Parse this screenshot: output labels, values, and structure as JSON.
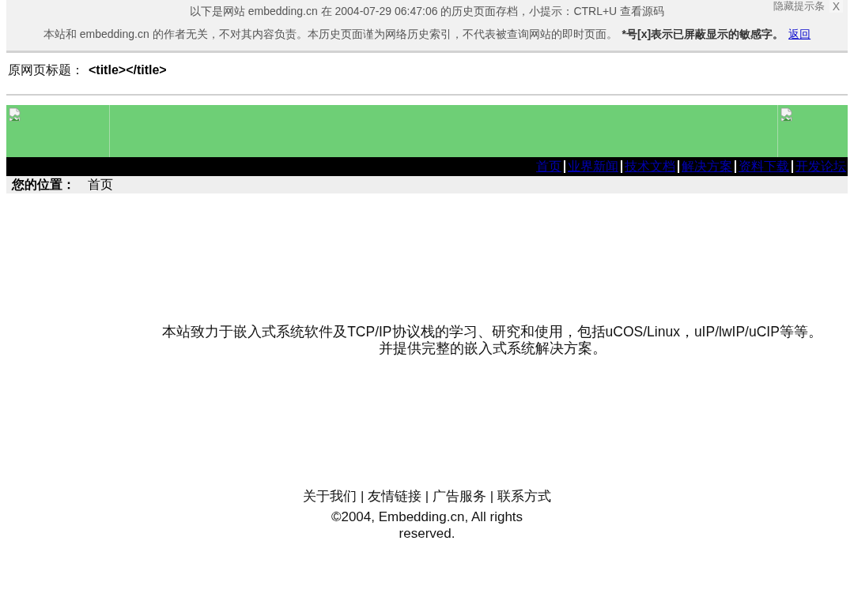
{
  "archive_notice": {
    "archived_line": "以下是网站 embedding.cn 在 2004-07-29 06:47:06 的历史页面存档，小提示：CTRL+U 查看源码",
    "hide_link": "隐藏提示条",
    "close_button": "X",
    "disclaimer": "本站和 embedding.cn 的作者无关，不对其内容负责。本历史页面谨为网络历史索引，不代表被查询网站的即时页面。",
    "disclaimer_emphasis": "*号[x]表示已屏蔽显示的敏感字。",
    "back_link": "返回"
  },
  "original_title": {
    "label": "原网页标题：",
    "value": "<title></title>"
  },
  "nav_links": [
    {
      "label": "首页"
    },
    {
      "label": "业界新闻"
    },
    {
      "label": "技术文档"
    },
    {
      "label": "解决方案"
    },
    {
      "label": "资料下载"
    },
    {
      "label": "开发论坛"
    }
  ],
  "breadcrumb": {
    "label": "您的位置：",
    "current": "首页"
  },
  "intro_lines": [
    "本站致力于嵌入式系统软件及TCP/IP协议栈的学习、研究和使用，包括uCOS/Linux，uIP/lwIP/uCIP等等。",
    "并提供完整的嵌入式系统解决方案。"
  ],
  "footer": {
    "links_line": "关于我们 | 友情链接 | 广告服务 | 联系方式",
    "copyright": "©2004, Embedding.cn, All rights reserved."
  }
}
